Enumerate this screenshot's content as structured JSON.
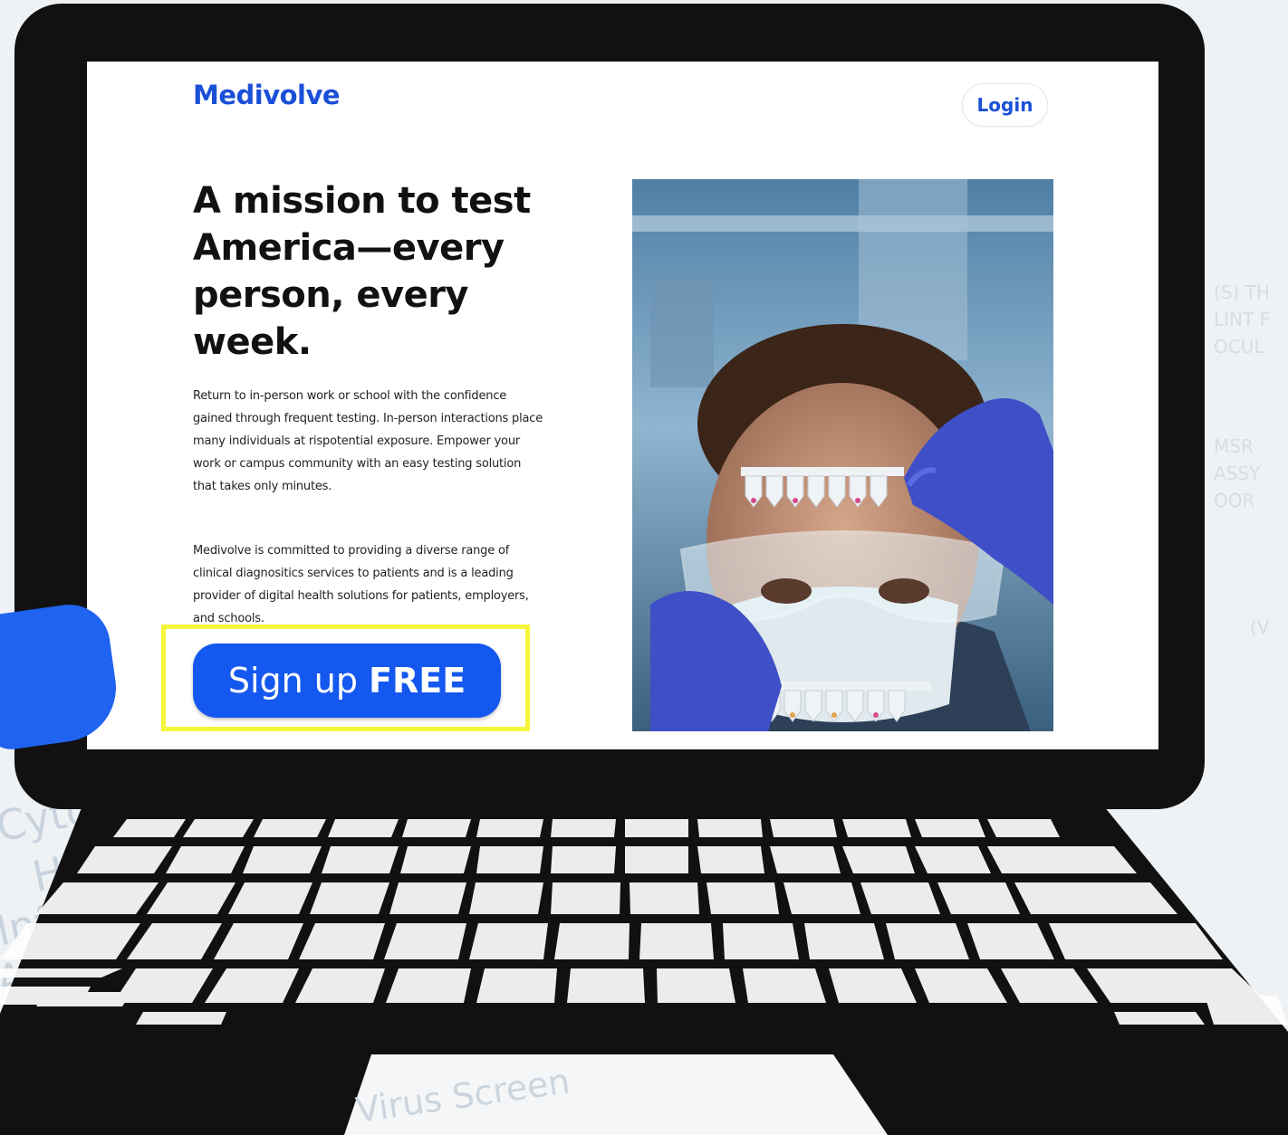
{
  "site": {
    "brand": "Medivolve",
    "login_label": "Login",
    "hero_title": "A mission to test America—every person, every week.",
    "paragraph_1": "Return to in-person work or school with the confidence gained through frequent testing. In-person interactions place many individuals at rispotential exposure. Empower your work or campus community with an easy testing solution that takes only minutes.",
    "paragraph_2": "Medivolve is committed to providing a diverse range of clinical diagnositics services to patients and is a leading provider of digital health solutions for patients, employers, and schools.",
    "signup_label": "Sign up",
    "signup_emphasis": "FREE"
  },
  "colors": {
    "brand_blue": "#1a50d8",
    "button_blue": "#1458f0",
    "highlight": "#f5f53a",
    "laptop": "#111111"
  },
  "icons": {
    "pointer": "blue-hand-pointer-icon"
  }
}
